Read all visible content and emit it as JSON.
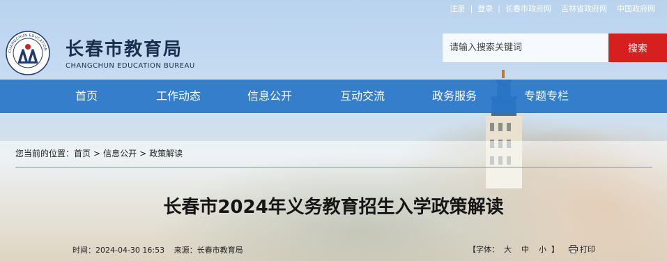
{
  "top_links": [
    "注册",
    "登录",
    "长春市政府网",
    "吉林省政府网",
    "中国政府网"
  ],
  "logo": {
    "name_cn": "长春市教育局",
    "name_en": "CHANGCHUN EDUCATION BUREAU",
    "emblem_text": "CHANGCHUN EDUCATION BUREAU"
  },
  "search": {
    "placeholder": "请输入搜索关键词",
    "button": "搜索"
  },
  "nav": [
    "首页",
    "工作动态",
    "信息公开",
    "互动交流",
    "政务服务",
    "专题专栏"
  ],
  "breadcrumb": {
    "prefix": "您当前的位置：",
    "items": [
      "首页",
      "信息公开",
      "政策解读"
    ],
    "separator": ">"
  },
  "article": {
    "title": "长春市2024年义务教育招生入学政策解读",
    "time_label": "时间：",
    "time": "2024-04-30 16:53",
    "source_label": "来源：",
    "source": "长春市教育局"
  },
  "font_tools": {
    "open": "【字体：",
    "large": "大",
    "medium": "中",
    "small": "小",
    "close": "】",
    "print": "打印"
  },
  "colors": {
    "nav_bg": "#2976c8",
    "search_button": "#d81f20",
    "brand_text": "#1c2f4f"
  }
}
